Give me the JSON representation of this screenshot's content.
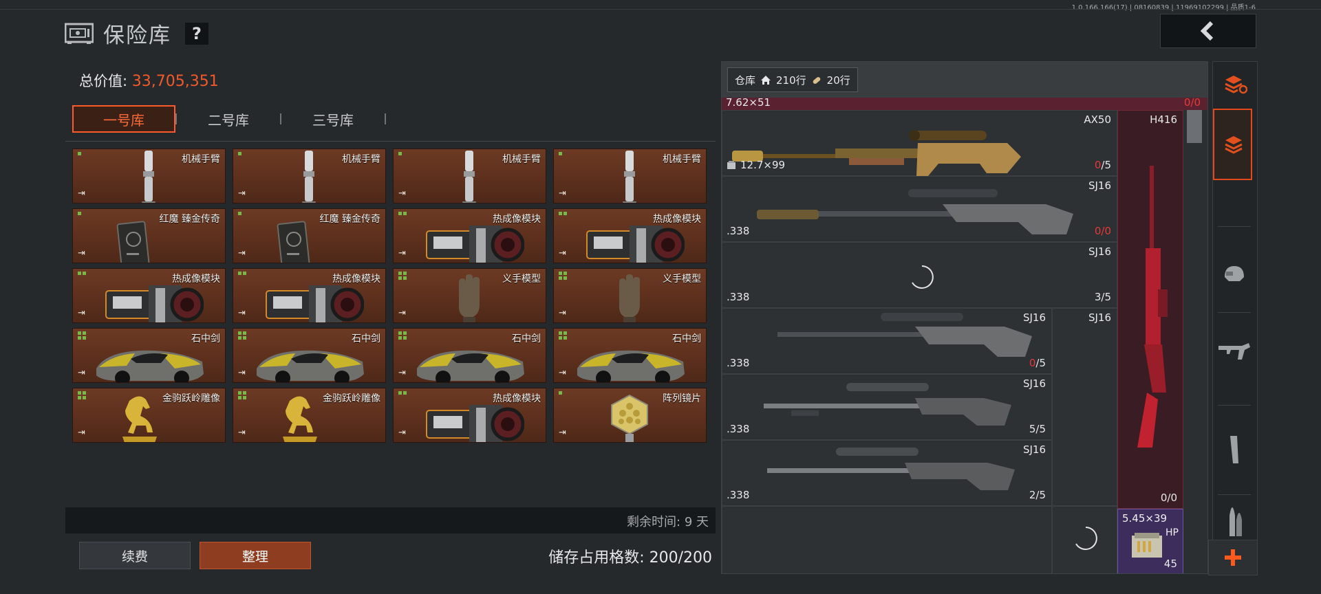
{
  "version": "1.0.166.166(17) | 08160839 | 11969102299 | 品质1-6",
  "header": {
    "title": "保险库",
    "help": "?"
  },
  "vault": {
    "total_label": "总价值:",
    "total_value": "33,705,351",
    "tabs": [
      {
        "label": "一号库",
        "active": true
      },
      {
        "label": "二号库",
        "active": false
      },
      {
        "label": "三号库",
        "active": false
      }
    ],
    "slots": [
      {
        "label": "机械手臂",
        "art": "arm-icon"
      },
      {
        "label": "机械手臂",
        "art": "arm-icon"
      },
      {
        "label": "机械手臂",
        "art": "arm-icon"
      },
      {
        "label": "机械手臂",
        "art": "arm-icon"
      },
      {
        "label": "红魔 臻金传奇",
        "art": "phone-icon"
      },
      {
        "label": "红魔 臻金传奇",
        "art": "phone-icon"
      },
      {
        "label": "热成像模块",
        "art": "thermal-module-icon"
      },
      {
        "label": "热成像模块",
        "art": "thermal-module-icon"
      },
      {
        "label": "热成像模块",
        "art": "thermal-module-icon"
      },
      {
        "label": "热成像模块",
        "art": "thermal-module-icon"
      },
      {
        "label": "义手模型",
        "art": "hand-model-icon"
      },
      {
        "label": "义手模型",
        "art": "hand-model-icon"
      },
      {
        "label": "石中剑",
        "art": "sports-car-icon"
      },
      {
        "label": "石中剑",
        "art": "sports-car-icon"
      },
      {
        "label": "石中剑",
        "art": "sports-car-icon"
      },
      {
        "label": "石中剑",
        "art": "sports-car-icon"
      },
      {
        "label": "金驹跃岭雕像",
        "art": "horse-statue-icon"
      },
      {
        "label": "金驹跃岭雕像",
        "art": "horse-statue-icon"
      },
      {
        "label": "热成像模块",
        "art": "thermal-module-icon"
      },
      {
        "label": "阵列镜片",
        "art": "lens-array-icon"
      }
    ],
    "remaining": "剩余时间: 9 天",
    "renew_label": "续费",
    "sort_label": "整理",
    "storage_label": "储存占用格数: 200/200"
  },
  "warehouse": {
    "title": "仓库",
    "rows_home": "210行",
    "rows_ammo": "20行",
    "top_strip_caliber": "7.62×51",
    "top_strip_count": "0/0",
    "weapons": [
      {
        "name": "AX50",
        "caliber": "12.7×99",
        "ammo_loaded": "0",
        "ammo_total": "/5"
      },
      {
        "name": "SJ16",
        "caliber": ".338",
        "ammo_loaded": "0",
        "ammo_total": "/0"
      },
      {
        "name": "SJ16",
        "caliber": ".338",
        "ammo_loaded": "3",
        "ammo_total": "/5"
      },
      {
        "name": "SJ16",
        "caliber": ".338",
        "ammo_loaded": "0",
        "ammo_total": "/5"
      },
      {
        "name": "SJ16",
        "caliber": ".338",
        "ammo_loaded": "5",
        "ammo_total": "/5"
      },
      {
        "name": "SJ16",
        "caliber": ".338",
        "ammo_loaded": "2",
        "ammo_total": "/5"
      }
    ],
    "side_weapons": [
      {
        "name": "H416",
        "count": "0/0"
      },
      {
        "name": "SJ16"
      }
    ],
    "ammo_box": {
      "caliber": "5.45×39",
      "type": "HP",
      "count": "45"
    }
  },
  "rail": {
    "icons": [
      "stack-refresh-icon",
      "stack-icon",
      "helmet-icon",
      "rifle-icon",
      "magazine-icon",
      "bullet-icon",
      "plus-icon"
    ]
  },
  "colors": {
    "accent": "#f05a2a",
    "slot_bg": "#6c3a24",
    "quality_green": "#7ab84a",
    "alert_red": "#e53a3a"
  }
}
